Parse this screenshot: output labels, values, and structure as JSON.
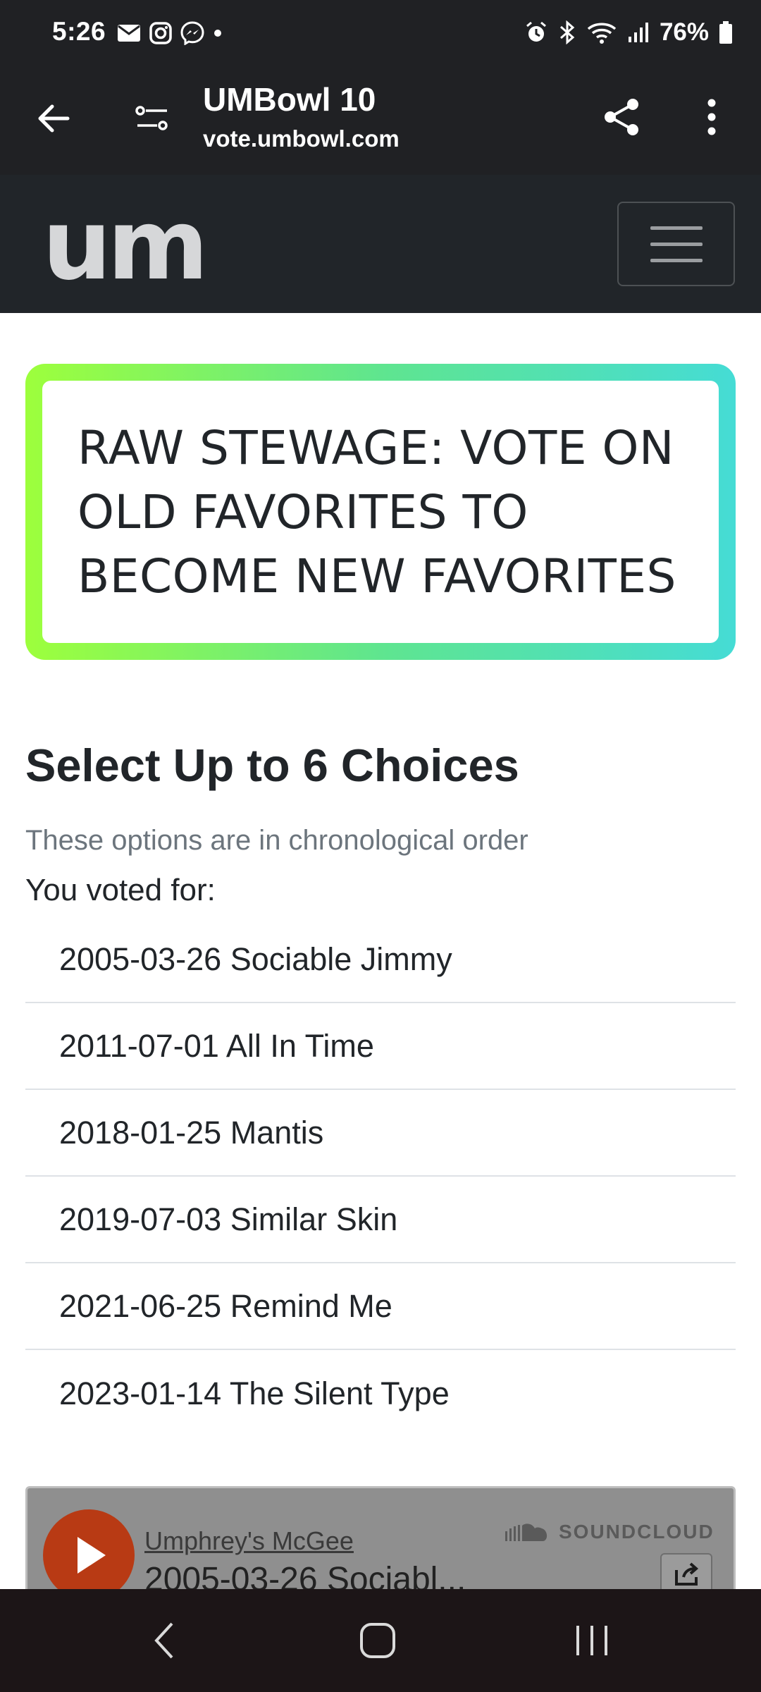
{
  "status_bar": {
    "time": "5:26",
    "battery": "76%",
    "left_icons": [
      "mail-icon",
      "instagram-icon",
      "messenger-icon",
      "dot-icon"
    ],
    "right_icons": [
      "alarm-icon",
      "bluetooth-icon",
      "wifi-icon",
      "signal-icon",
      "battery-icon"
    ]
  },
  "browser": {
    "title": "UMBowl 10",
    "url": "vote.umbowl.com"
  },
  "site": {
    "logo_text": "um"
  },
  "banner": {
    "lines": [
      "RAW STEWAGE: VOTE ON",
      "OLD FAVORITES TO",
      "BECOME NEW FAVORITES"
    ]
  },
  "content": {
    "title": "Select Up to 6 Choices",
    "subtitle": "These options are in chronological order",
    "voted_label": "You voted for:",
    "votes": [
      "2005-03-26 Sociable Jimmy",
      "2011-07-01 All In Time",
      "2018-01-25 Mantis",
      "2019-07-03 Similar Skin",
      "2021-06-25 Remind Me",
      "2023-01-14 The Silent Type"
    ]
  },
  "soundcloud": {
    "artist": "Umphrey's McGee",
    "track": "2005-03-26 Sociabl...",
    "brand": "SOUNDCLOUD"
  },
  "colors": {
    "chrome": "#202124",
    "navbar": "#212529",
    "gradient_start": "#9dff3c",
    "gradient_end": "#45dcd5",
    "sc_play": "#b83a14"
  }
}
